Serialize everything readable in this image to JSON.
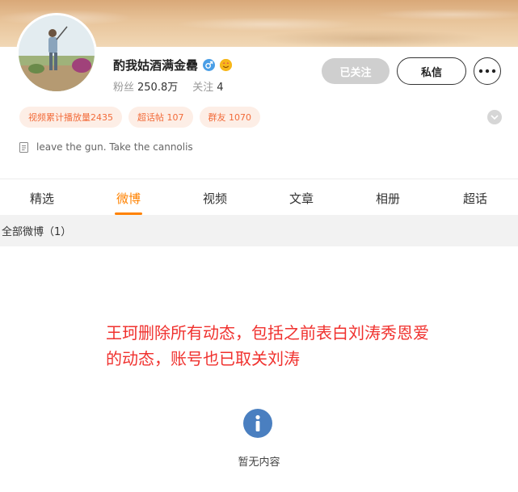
{
  "profile": {
    "name": "酌我姑酒满金罍",
    "followers_label": "粉丝",
    "followers_value": "250.8万",
    "following_label": "关注",
    "following_value": "4",
    "gender_icon": "male-gender-icon",
    "badge_icon": "smiling-face-badge-icon"
  },
  "actions": {
    "followed_label": "已关注",
    "message_label": "私信",
    "more_icon": "more-dots-icon"
  },
  "tags": [
    "视频累计播放量2435",
    "超话帖 107",
    "群友 1070"
  ],
  "bio": {
    "icon": "document-icon",
    "text": "leave the gun. Take the cannolis"
  },
  "tabs": [
    {
      "label": "精选",
      "active": false
    },
    {
      "label": "微博",
      "active": true
    },
    {
      "label": "视频",
      "active": false
    },
    {
      "label": "文章",
      "active": false
    },
    {
      "label": "相册",
      "active": false
    },
    {
      "label": "超话",
      "active": false
    }
  ],
  "filter": {
    "label": "全部微博（1）"
  },
  "caption": {
    "line1": "王珂删除所有动态，包括之前表白刘涛秀恩爱",
    "line2": "的动态，账号也已取关刘涛"
  },
  "empty_state": {
    "icon": "info-icon",
    "text": "暂无内容"
  },
  "colors": {
    "accent": "#ff8200",
    "tag_text": "#f26b3a",
    "tag_bg": "#fdeee6",
    "caption": "#f0312e",
    "info_icon": "#4a7fc0"
  }
}
